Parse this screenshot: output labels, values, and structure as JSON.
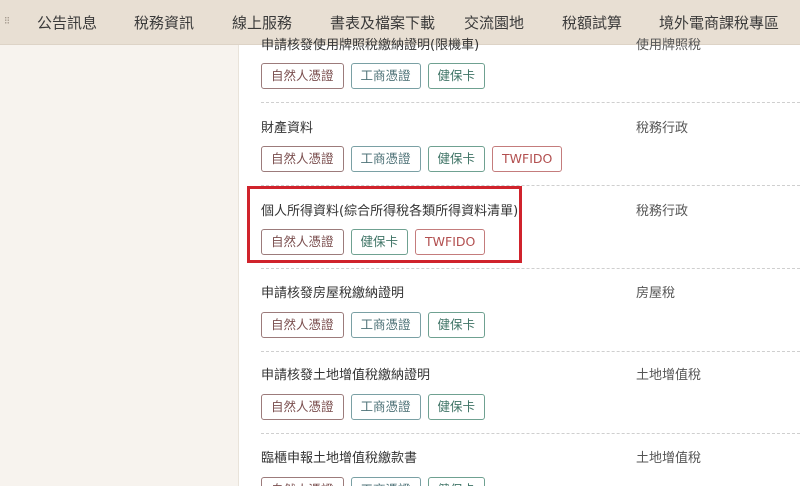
{
  "nav": {
    "grip": "⁝⁝",
    "items": [
      "公告訊息",
      "稅務資訊",
      "線上服務",
      "書表及檔案下載",
      "交流園地",
      "稅額試算",
      "境外電商課稅專區"
    ]
  },
  "rows": [
    {
      "title": "申請核發使用牌照稅繳納證明(限機車)",
      "category": "使用牌照稅",
      "tags": [
        "自然人憑證",
        "工商憑證",
        "健保卡"
      ]
    },
    {
      "title": "財產資料",
      "category": "稅務行政",
      "tags": [
        "自然人憑證",
        "工商憑證",
        "健保卡",
        "TWFIDO"
      ]
    },
    {
      "title": "個人所得資料(綜合所得稅各類所得資料清單)",
      "category": "稅務行政",
      "tags": [
        "自然人憑證",
        "健保卡",
        "TWFIDO"
      ]
    },
    {
      "title": "申請核發房屋稅繳納證明",
      "category": "房屋稅",
      "tags": [
        "自然人憑證",
        "工商憑證",
        "健保卡"
      ]
    },
    {
      "title": "申請核發土地增值稅繳納證明",
      "category": "土地增值稅",
      "tags": [
        "自然人憑證",
        "工商憑證",
        "健保卡"
      ]
    },
    {
      "title": "臨櫃申報土地增值稅繳款書",
      "category": "土地增值稅",
      "tags": [
        "自然人憑證",
        "工商憑證",
        "健保卡"
      ]
    }
  ],
  "colors": {
    "nav_bg": "#e8dfd3",
    "highlight": "#d0232c"
  }
}
